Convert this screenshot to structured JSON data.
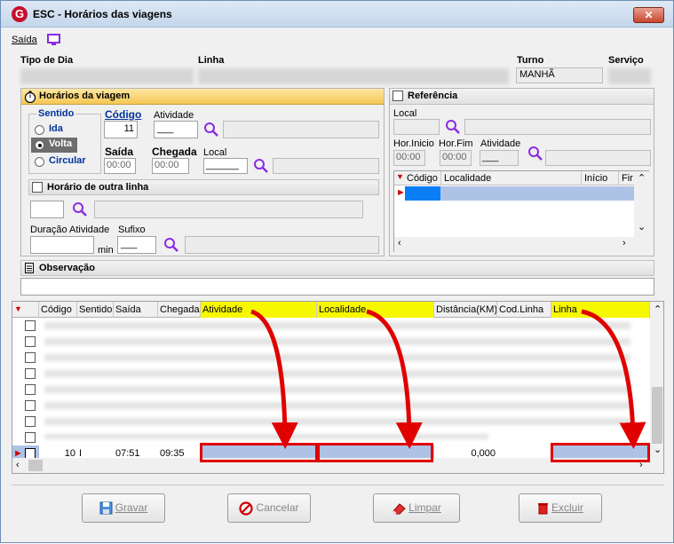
{
  "window": {
    "title": "ESC - Horários das viagens",
    "logo_letter": "G",
    "close": "✕"
  },
  "menu": {
    "saida": "Saída"
  },
  "header": {
    "tipo_dia_label": "Tipo de Dia",
    "linha_label": "Linha",
    "turno_label": "Turno",
    "servico_label": "Serviço",
    "turno_value": "MANHÃ"
  },
  "horarios": {
    "title": "Horários da viagem",
    "sentido_label": "Sentido",
    "options": [
      "Ida",
      "Volta",
      "Circular"
    ],
    "selected": "Volta",
    "codigo_label": "Código",
    "codigo_value": "11",
    "atividade_label": "Atividade",
    "atividade_value": "___",
    "saida_label": "Saída",
    "saida_value": "00:00",
    "chegada_label": "Chegada",
    "chegada_value": "00:00",
    "local_label": "Local",
    "local_value": "______"
  },
  "outra_linha": {
    "title": "Horário de outra linha",
    "duracao_label": "Duração Atividade",
    "min_label": "min",
    "sufixo_label": "Sufixo",
    "sufixo_value": "___"
  },
  "referencia": {
    "title": "Referência",
    "local_label": "Local",
    "hor_inicio_label": "Hor.Inicio",
    "hor_inicio_value": "00:00",
    "hor_fim_label": "Hor.Fim",
    "hor_fim_value": "00:00",
    "atividade_label": "Atividade",
    "atividade_value": "___",
    "columns": [
      "Código",
      "Localidade",
      "Início",
      "Fir"
    ]
  },
  "observacao": {
    "title": "Observação"
  },
  "grid": {
    "columns": [
      "Código",
      "Sentido",
      "Saída",
      "Chegada",
      "Atividade",
      "Localidade",
      "Distância(KM)",
      "Cod.Linha",
      "Linha"
    ],
    "highlight_columns": [
      "Atividade",
      "Localidade",
      "Linha"
    ],
    "current_row": {
      "codigo": "10",
      "sentido": "I",
      "saida": "07:51",
      "chegada": "09:35",
      "distancia": "0,000"
    }
  },
  "buttons": {
    "gravar": "Gravar",
    "cancelar": "Cancelar",
    "limpar": "Limpar",
    "excluir": "Excluir"
  },
  "colors": {
    "accent_yellow": "#f7f700",
    "selection": "#aec2e6",
    "arrow_red": "#e00000"
  }
}
